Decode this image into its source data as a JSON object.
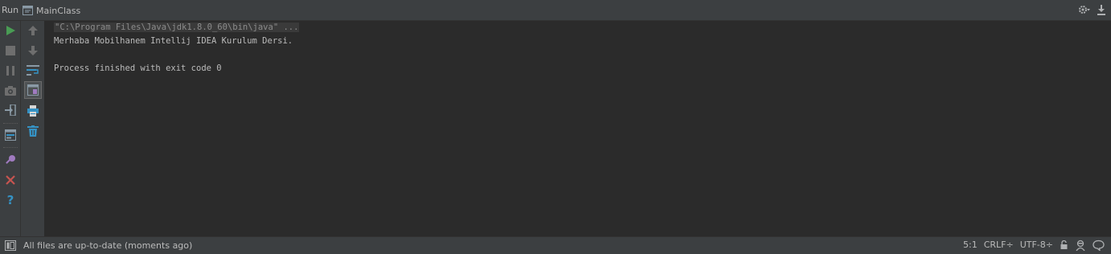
{
  "header": {
    "title": "Run",
    "tab_label": "MainClass"
  },
  "console": {
    "command": "\"C:\\Program Files\\Java\\jdk1.8.0_60\\bin\\java\" ...",
    "lines": [
      "Merhaba Mobilhanem Intellij IDEA Kurulum Dersi.",
      "",
      "Process finished with exit code 0"
    ]
  },
  "left_toolbar": [
    "rerun-icon",
    "stop-icon",
    "pause-icon",
    "dump-threads-icon",
    "exit-icon",
    "restore-layout-icon",
    "pin-icon",
    "close-icon",
    "help-icon"
  ],
  "right_toolbar": [
    "up-arrow-icon",
    "down-arrow-icon",
    "soft-wrap-icon",
    "scroll-to-end-icon",
    "print-icon",
    "clear-all-icon"
  ],
  "status": {
    "message": "All files are up-to-date (moments ago)",
    "position": "5:1",
    "line_separator": "CRLF÷",
    "encoding": "UTF-8÷"
  },
  "colors": {
    "run_green": "#499c54",
    "close_red": "#c75450",
    "help_blue": "#3592c4",
    "icon_gray": "#7f8b91"
  }
}
